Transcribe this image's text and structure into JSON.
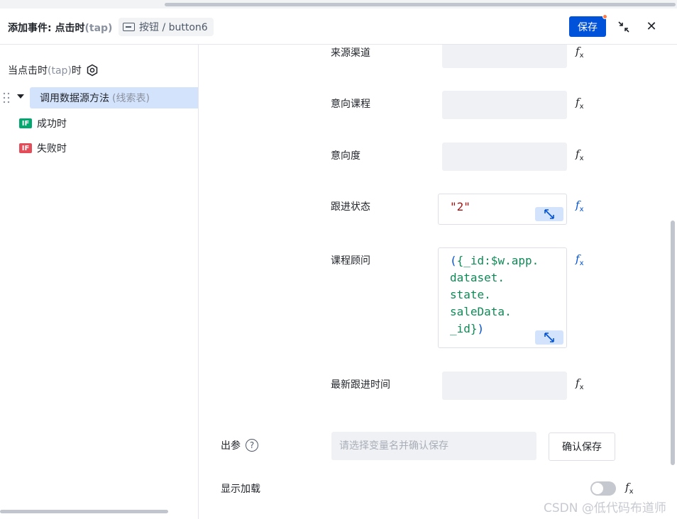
{
  "header": {
    "title_prefix": "添加事件: 点击时",
    "title_tap": "(tap)",
    "breadcrumb": "按钮 / button6",
    "save_label": "保存",
    "close_glyph": "✕"
  },
  "sidebar": {
    "event_label": "当点击时",
    "event_tap": "(tap)",
    "event_suffix": "时",
    "action_label": "调用数据源方法",
    "action_sub": "(线索表)",
    "success_badge": "IF",
    "success_label": "成功时",
    "fail_badge": "IF",
    "fail_label": "失败时"
  },
  "fields": {
    "source_channel": "来源渠道",
    "intended_course": "意向课程",
    "intent_level": "意向度",
    "follow_status": "跟进状态",
    "follow_status_value": "\"2\"",
    "course_advisor": "课程顾问",
    "course_advisor_lines": [
      "({_id:$w.app.",
      "dataset.",
      "state.",
      "saleData.",
      "_id})"
    ],
    "latest_follow_time": "最新跟进时间",
    "fx": "f",
    "fx_sub": "x"
  },
  "output": {
    "label": "出参",
    "help_glyph": "?",
    "placeholder": "请选择变量名并确认保存",
    "confirm_label": "确认保存",
    "loading_label": "显示加载",
    "loading_on": false
  },
  "watermark": "CSDN @低代码布道师",
  "colors": {
    "primary": "#0052d9",
    "selected_bg": "#d4e3fc",
    "success": "#00a870",
    "danger": "#e34d59",
    "string": "#a31515",
    "code": "#0f8a57"
  }
}
